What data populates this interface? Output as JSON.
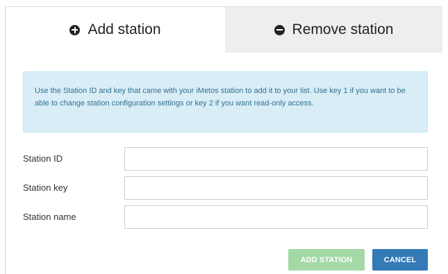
{
  "tabs": {
    "add_label": "Add station",
    "remove_label": "Remove station"
  },
  "info_text": "Use the Station ID and key that came with your iMetos station to add it to your list. Use key 1 if you want to be able to change station configuration settings or key 2 if you want read-only access.",
  "form": {
    "station_id": {
      "label": "Station ID",
      "value": ""
    },
    "station_key": {
      "label": "Station key",
      "value": ""
    },
    "station_name": {
      "label": "Station name",
      "value": ""
    }
  },
  "buttons": {
    "add_label": "ADD STATION",
    "cancel_label": "CANCEL"
  },
  "colors": {
    "add_button": "#a3d9a5",
    "cancel_button": "#337ab7",
    "info_background": "#d9edf7",
    "info_text": "#31708f",
    "inactive_tab": "#eeeeee"
  },
  "icons": {
    "add_tab": "plus-circle-icon",
    "remove_tab": "minus-circle-icon"
  }
}
